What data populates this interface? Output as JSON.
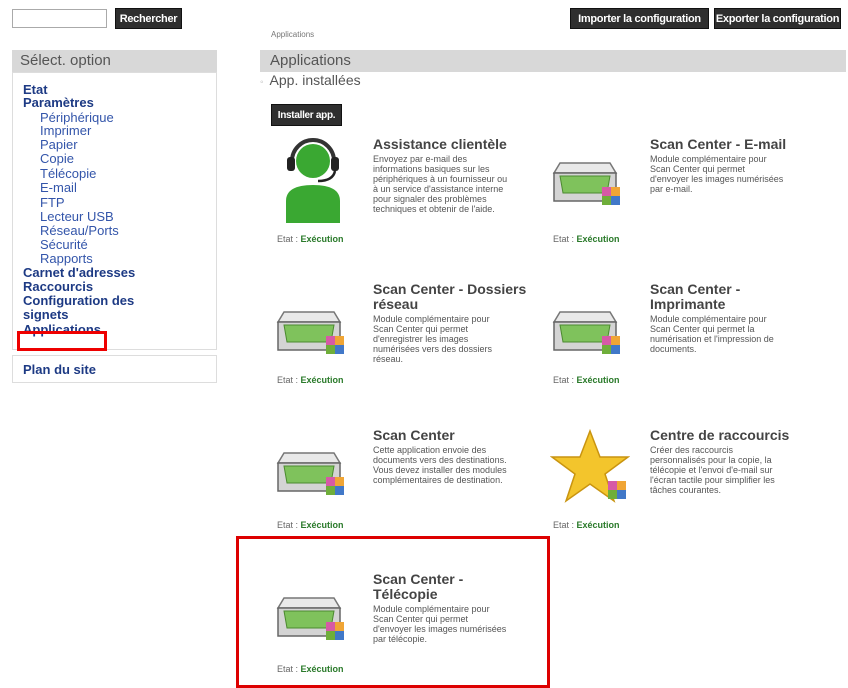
{
  "search": {
    "value": "",
    "button": "Rechercher"
  },
  "toolbar": {
    "import": "Importer la configuration",
    "export": "Exporter la configuration"
  },
  "breadcrumb": "Applications",
  "left": {
    "header": "Sélect. option",
    "items": [
      {
        "label": "Etat",
        "level": 0
      },
      {
        "label": "Paramètres",
        "level": 0
      },
      {
        "label": "Périphérique",
        "level": 1
      },
      {
        "label": "Imprimer",
        "level": 1
      },
      {
        "label": "Papier",
        "level": 1
      },
      {
        "label": "Copie",
        "level": 1
      },
      {
        "label": "Télécopie",
        "level": 1
      },
      {
        "label": "E-mail",
        "level": 1
      },
      {
        "label": "FTP",
        "level": 1
      },
      {
        "label": "Lecteur USB",
        "level": 1
      },
      {
        "label": "Réseau/Ports",
        "level": 1
      },
      {
        "label": "Sécurité",
        "level": 1
      },
      {
        "label": "Rapports",
        "level": 1
      },
      {
        "label": "Carnet d'adresses",
        "level": 0
      },
      {
        "label": "Raccourcis",
        "level": 0
      },
      {
        "label": "Configuration des",
        "level": 0
      },
      {
        "label": "signets",
        "level": 0
      },
      {
        "label": "Applications",
        "level": 0,
        "selected": true
      }
    ],
    "sitemap": "Plan du site"
  },
  "main": {
    "header": "Applications",
    "subsection": "App. installées",
    "install_button": "Installer app.",
    "status_label": "Etat :",
    "apps": [
      {
        "title": "Assistance clientèle",
        "desc": [
          "Envoyez par e-mail des",
          "informations basiques sur les",
          "périphériques à un fournisseur ou",
          "à un service d'assistance interne",
          "pour signaler des problèmes",
          "techniques et obtenir de l'aide."
        ],
        "status": "Exécution",
        "icon": "support-agent-icon"
      },
      {
        "title": "Scan Center - E-mail",
        "desc": [
          "Module complémentaire pour",
          "Scan Center qui permet",
          "d'envoyer les images numérisées",
          "par e-mail."
        ],
        "status": "Exécution",
        "icon": "scanner-icon"
      },
      {
        "title": "Scan Center - Dossiers réseau",
        "title_lines": [
          "Scan Center - Dossiers",
          "réseau"
        ],
        "desc": [
          "Module complémentaire pour",
          "Scan Center qui permet",
          "d'enregistrer les images",
          "numérisées vers des dossiers",
          "réseau."
        ],
        "status": "Exécution",
        "icon": "scanner-icon"
      },
      {
        "title": "Scan Center - Imprimante",
        "title_lines": [
          "Scan Center -",
          "Imprimante"
        ],
        "desc": [
          "Module complémentaire pour",
          "Scan Center qui permet la",
          "numérisation et l'impression de",
          "documents."
        ],
        "status": "Exécution",
        "icon": "scanner-icon"
      },
      {
        "title": "Scan Center",
        "desc": [
          "Cette application envoie des",
          "documents vers des destinations.",
          "Vous devez installer des modules",
          "complémentaires de destination."
        ],
        "status": "Exécution",
        "icon": "scanner-icon"
      },
      {
        "title": "Centre de raccourcis",
        "desc": [
          "Créer des raccourcis",
          "personnalisés pour la copie, la",
          "télécopie et l'envoi d'e-mail sur",
          "l'écran tactile pour simplifier les",
          "tâches courantes."
        ],
        "status": "Exécution",
        "icon": "star-icon"
      },
      {
        "title": "Scan Center - Télécopie",
        "title_lines": [
          "Scan Center -",
          "Télécopie"
        ],
        "desc": [
          "Module complémentaire pour",
          "Scan Center qui permet",
          "d'envoyer les images numérisées",
          "par télécopie."
        ],
        "status": "Exécution",
        "icon": "scanner-icon"
      }
    ]
  },
  "colors": {
    "button_dark": "#2f2f2f",
    "highlight": "#e00000",
    "status_green": "#2a7a2a",
    "link_blue": "#1d3a84"
  }
}
